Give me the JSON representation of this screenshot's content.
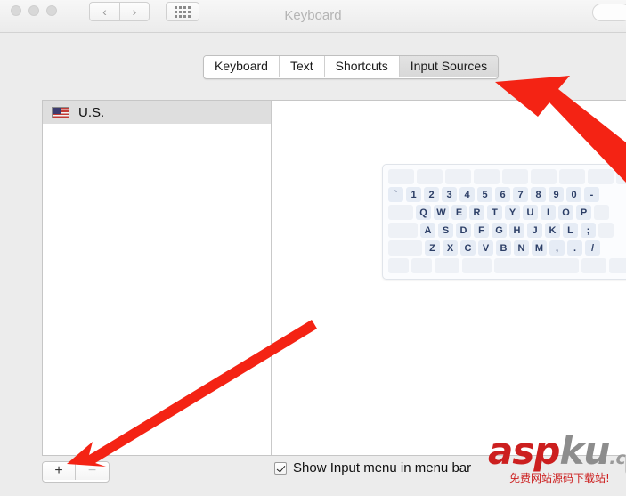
{
  "window": {
    "title": "Keyboard",
    "traffic_lights": [
      "close",
      "minimize",
      "zoom"
    ],
    "nav_back": "‹",
    "nav_forward": "›",
    "show_all_icon": "grid-icon"
  },
  "tabs": [
    {
      "label": "Keyboard",
      "active": false
    },
    {
      "label": "Text",
      "active": false
    },
    {
      "label": "Shortcuts",
      "active": false
    },
    {
      "label": "Input Sources",
      "active": true
    }
  ],
  "sidebar": {
    "items": [
      {
        "label": "U.S.",
        "icon": "us-flag-icon",
        "selected": true
      }
    ]
  },
  "buttons": {
    "add": "+",
    "remove": "−"
  },
  "checkbox": {
    "label": "Show Input menu in menu bar",
    "checked": true
  },
  "keyboard_preview": {
    "rows": [
      [
        "",
        "",
        "",
        "",
        "",
        "",
        "",
        "",
        "",
        "",
        "",
        ""
      ],
      [
        "`",
        "1",
        "2",
        "3",
        "4",
        "5",
        "6",
        "7",
        "8",
        "9",
        "0",
        "-"
      ],
      [
        "",
        "Q",
        "W",
        "E",
        "R",
        "T",
        "Y",
        "U",
        "I",
        "O",
        "P",
        ""
      ],
      [
        "",
        "A",
        "S",
        "D",
        "F",
        "G",
        "H",
        "J",
        "K",
        "L",
        ";",
        ""
      ],
      [
        "",
        "Z",
        "X",
        "C",
        "V",
        "B",
        "N",
        "M",
        ",",
        ".",
        "/",
        ""
      ],
      [
        "",
        "",
        "",
        "",
        "",
        "",
        ""
      ]
    ]
  },
  "annotations": {
    "arrow_color": "#f42314",
    "arrows": [
      {
        "name": "arrow-to-input-sources-tab",
        "points_to": "Input Sources"
      },
      {
        "name": "arrow-to-add-button",
        "points_to": "+"
      }
    ]
  },
  "watermark": {
    "asp": "asp",
    "ku": "ku",
    "com": ".com",
    "subtitle": "免费网站源码下载站!"
  }
}
